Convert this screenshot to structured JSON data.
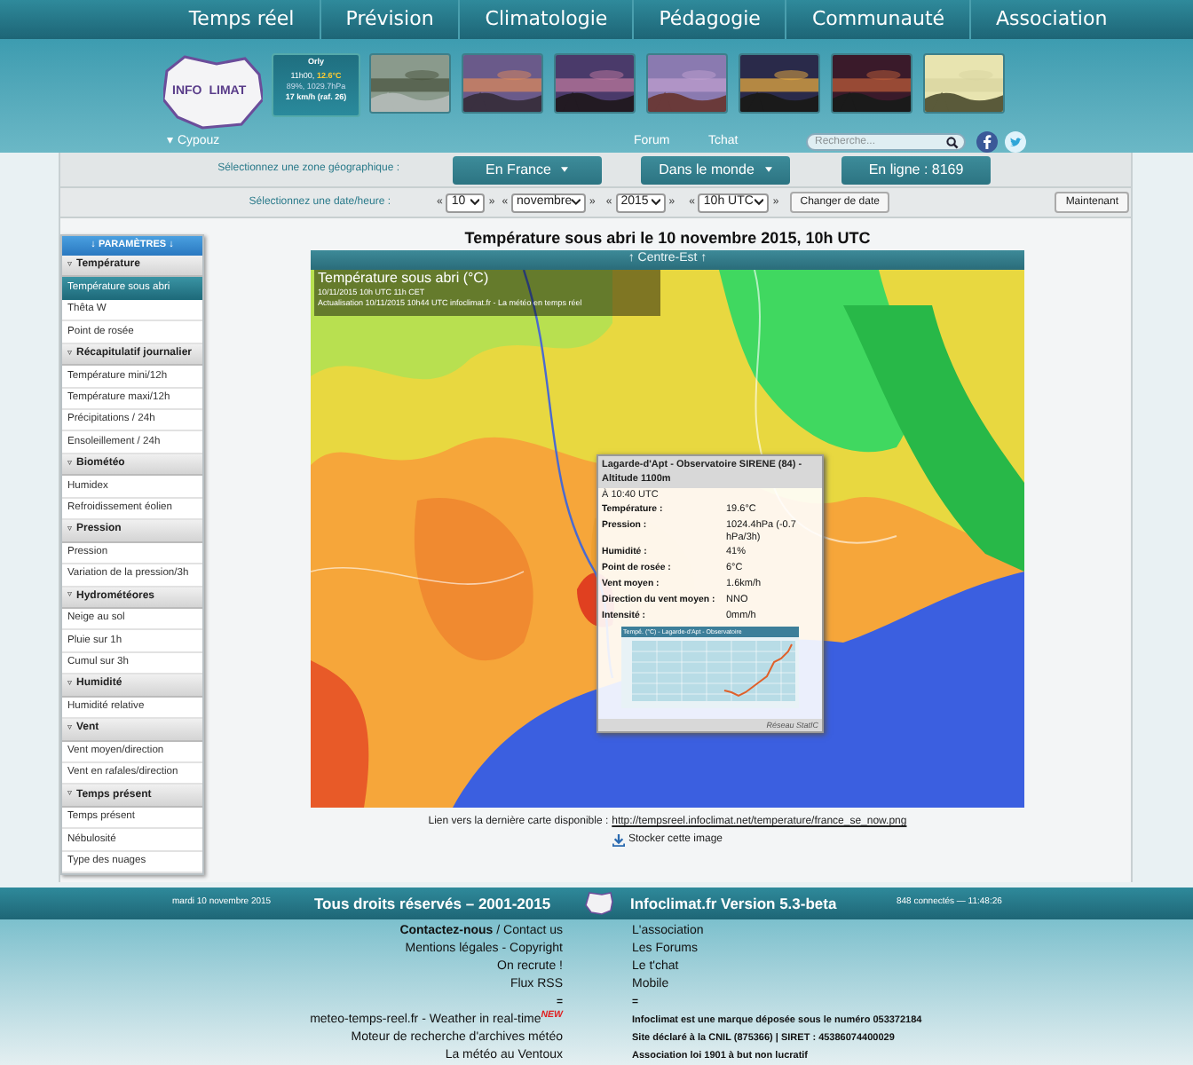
{
  "nav": [
    {
      "label": "Temps réel"
    },
    {
      "label": "Prévision"
    },
    {
      "label": "Climatologie"
    },
    {
      "label": "Pédagogie"
    },
    {
      "label": "Communauté"
    },
    {
      "label": "Association"
    }
  ],
  "header": {
    "logo_left": "INFO",
    "logo_right": "LIMAT",
    "widget": {
      "station": "Orly",
      "time": "11h00,",
      "temperature": "12.6°C",
      "humidity_pressure": "89%, 1029.7hPa",
      "wind": "17 km/h (raf. 26)"
    },
    "thumbnails": [
      {
        "kind": "picture"
      },
      {
        "kind": "picture"
      },
      {
        "kind": "picture"
      },
      {
        "kind": "picture"
      },
      {
        "kind": "picture"
      },
      {
        "kind": "picture"
      },
      {
        "kind": "picture"
      }
    ],
    "user_marker": "▾",
    "user": "Cypouz",
    "links": [
      "Forum",
      "Tchat"
    ],
    "search": {
      "placeholder": "Recherche..."
    }
  },
  "zone": {
    "label": "Sélectionnez une zone géographique :",
    "buttons": [
      {
        "label": "En France",
        "kind": "dropdown"
      },
      {
        "label": "Dans le monde",
        "kind": "dropdown"
      },
      {
        "label": "En ligne : 8169",
        "kind": "plain"
      }
    ]
  },
  "date": {
    "label": "Sélectionnez une date/heure :",
    "selects": [
      {
        "prev": "«",
        "value": "10",
        "next": "»"
      },
      {
        "prev": "«",
        "value": "novembre",
        "next": "»"
      },
      {
        "prev": "«",
        "value": "2015",
        "next": "»"
      },
      {
        "prev": "«",
        "value": "10h UTC",
        "next": "»"
      }
    ],
    "change_button": "Changer de date",
    "now_button": "Maintenant"
  },
  "sidebar": {
    "title": "↓ PARAMÈTRES ↓",
    "sections": [
      {
        "marker": "▿",
        "title": "Température",
        "items": [
          {
            "label": "Température sous abri",
            "selected": true
          },
          {
            "label": "Thêta W",
            "selected": false
          },
          {
            "label": "Point de rosée",
            "selected": false
          }
        ]
      },
      {
        "marker": "▿",
        "title": "Récapitulatif journalier",
        "items": [
          {
            "label": "Température mini/12h",
            "selected": false
          },
          {
            "label": "Température maxi/12h",
            "selected": false
          },
          {
            "label": "Précipitations / 24h",
            "selected": false
          },
          {
            "label": "Ensoleillement / 24h",
            "selected": false
          }
        ]
      },
      {
        "marker": "▿",
        "title": "Biométéo",
        "items": [
          {
            "label": "Humidex",
            "selected": false
          },
          {
            "label": "Refroidissement éolien",
            "selected": false
          }
        ]
      },
      {
        "marker": "▿",
        "title": "Pression",
        "items": [
          {
            "label": "Pression",
            "selected": false
          },
          {
            "label": "Variation de la pression/3h",
            "selected": false
          }
        ]
      },
      {
        "marker": "▿",
        "title": "Hydrométéores",
        "items": [
          {
            "label": "Neige au sol",
            "selected": false
          },
          {
            "label": "Pluie sur 1h",
            "selected": false
          },
          {
            "label": "Cumul sur 3h",
            "selected": false
          }
        ]
      },
      {
        "marker": "▿",
        "title": "Humidité",
        "items": [
          {
            "label": "Humidité relative",
            "selected": false
          }
        ]
      },
      {
        "marker": "▿",
        "title": "Vent",
        "items": [
          {
            "label": "Vent moyen/direction",
            "selected": false
          },
          {
            "label": "Vent en rafales/direction",
            "selected": false
          }
        ]
      },
      {
        "marker": "▿",
        "title": "Temps présent",
        "items": [
          {
            "label": "Temps présent",
            "selected": false
          },
          {
            "label": "Nébulosité",
            "selected": false
          },
          {
            "label": "Type des nuages",
            "selected": false
          }
        ]
      }
    ]
  },
  "map": {
    "title": "Température sous abri le 10 novembre 2015, 10h UTC",
    "region": "↑ Centre-Est ↑",
    "caption": {
      "title": "Température sous abri (°C)",
      "line1": "10/11/2015  10h UTC  11h CET",
      "line2": "Actualisation 10/11/2015 10h44 UTC   infoclimat.fr - La météo en temps réel"
    },
    "popup": {
      "title": "Lagarde-d'Apt - Observatoire SIRENE (84) - Altitude 1100m",
      "time": "À 10:40 UTC",
      "rows": [
        {
          "label": "Température :",
          "value": "19.6°C"
        },
        {
          "label": "Pression :",
          "value": "1024.4hPa (-0.7 hPa/3h)"
        },
        {
          "label": "Humidité :",
          "value": "41%"
        },
        {
          "label": "Point de rosée :",
          "value": "6°C"
        },
        {
          "label": "Vent moyen :",
          "value": "1.6km/h"
        },
        {
          "label": "Direction du vent moyen :",
          "value": "NNO"
        },
        {
          "label": "Intensité :",
          "value": "0mm/h"
        }
      ],
      "chart_title": "Tempé. (°C) - Lagarde-d'Apt - Observatoire",
      "network": "Réseau StatIC"
    },
    "link_label": "Lien vers la dernière carte disponible :",
    "link_url": "http://tempsreel.infoclimat.net/temperature/france_se_now.png",
    "store": "Stocker cette image"
  },
  "footer": {
    "date": "mardi 10 novembre 2015",
    "copyright": "Tous droits réservés – 2001-2015",
    "version": "Infoclimat.fr Version 5.3-beta",
    "online": "848 connectés — 11:48:26",
    "left": [
      {
        "text": "**Contactez-nous** / Contact us",
        "kind": "link"
      },
      {
        "text": "Mentions légales - Copyright",
        "kind": "link"
      },
      {
        "text": "On recrute !",
        "kind": "link"
      },
      {
        "text": "Flux RSS",
        "kind": "link"
      },
      {
        "text": "=",
        "kind": "sep"
      },
      {
        "text": "meteo-temps-reel.fr - Weather in real-time$^{NEW}$",
        "kind": "link"
      },
      {
        "text": "Moteur de recherche d'archives météo",
        "kind": "link"
      },
      {
        "text": "La météo au Ventoux",
        "kind": "link"
      }
    ],
    "right": [
      {
        "text": "L'association",
        "kind": "link"
      },
      {
        "text": "Les Forums",
        "kind": "link"
      },
      {
        "text": "Le t'chat",
        "kind": "link"
      },
      {
        "text": "Mobile",
        "kind": "link"
      },
      {
        "text": "=",
        "kind": "sep"
      },
      {
        "text": "Infoclimat est une marque déposée sous le numéro 053372184",
        "kind": "note"
      },
      {
        "text": "Site déclaré à la CNIL (875366) | SIRET : 45386074400029",
        "kind": "note"
      },
      {
        "text": "Association loi 1901 à but non lucratif",
        "kind": "note"
      }
    ]
  }
}
